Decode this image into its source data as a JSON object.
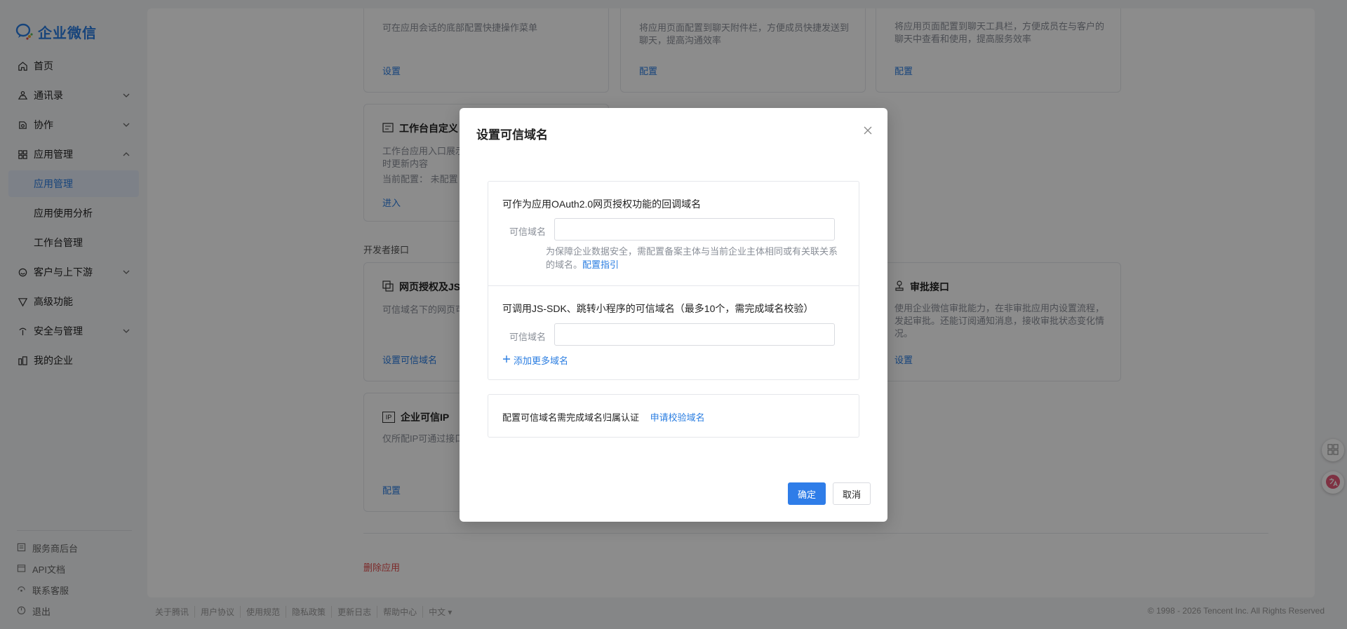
{
  "app": {
    "logo_text": "企业微信"
  },
  "sidebar": {
    "items": [
      {
        "label": "首页",
        "icon": "home-icon"
      },
      {
        "label": "通讯录",
        "icon": "contacts-icon",
        "expandable": true
      },
      {
        "label": "协作",
        "icon": "collab-icon",
        "expandable": true
      },
      {
        "label": "应用管理",
        "icon": "apps-icon",
        "expandable": true,
        "expanded": true
      },
      {
        "label": "应用管理",
        "sub": true,
        "active": true
      },
      {
        "label": "应用使用分析",
        "sub": true
      },
      {
        "label": "工作台管理",
        "sub": true
      },
      {
        "label": "客户与上下游",
        "icon": "customer-icon",
        "expandable": true
      },
      {
        "label": "高级功能",
        "icon": "advanced-icon"
      },
      {
        "label": "安全与管理",
        "icon": "security-icon",
        "expandable": true
      },
      {
        "label": "我的企业",
        "icon": "company-icon"
      }
    ],
    "footer": [
      {
        "label": "服务商后台",
        "icon": "vendor-icon"
      },
      {
        "label": "API文档",
        "icon": "api-doc-icon"
      },
      {
        "label": "联系客服",
        "icon": "support-icon"
      },
      {
        "label": "退出",
        "icon": "logout-icon"
      }
    ]
  },
  "main": {
    "cards_top": [
      {
        "desc": "可在应用会话的底部配置快捷操作菜单",
        "link": "设置"
      },
      {
        "desc": "将应用页面配置到聊天附件栏，方便成员快捷发送到聊天，提高沟通效率",
        "link": "配置"
      },
      {
        "desc": "将应用页面配置到聊天工具栏，方便成员在与客户的聊天中查看和使用，提高服务效率",
        "link": "配置"
      }
    ],
    "workbench_card": {
      "title": "工作台自定义",
      "desc": "工作台应用入口展示",
      "desc2": "时更新内容",
      "current_config": "当前配置：",
      "current_value": "未配置",
      "link": "进入"
    },
    "dev_section_label": "开发者接口",
    "oauth_card": {
      "title": "网页授权及JS",
      "desc": "可信域名下的网页可",
      "link": "设置可信域名"
    },
    "approval_card": {
      "title": "审批接口",
      "desc": "使用企业微信审批能力，在非审批应用内设置流程，发起审批。还能订阅通知消息，接收审批状态变化情况。",
      "link": "设置"
    },
    "ip_card": {
      "title": "企业可信IP",
      "icon_text": "IP",
      "desc": "仅所配IP可通过接口",
      "link": "配置"
    },
    "delete_label": "删除应用"
  },
  "footer": {
    "links": [
      "关于腾讯",
      "用户协议",
      "使用规范",
      "隐私政策",
      "更新日志",
      "帮助中心",
      "中文 ▾"
    ],
    "copyright": "© 1998 - 2026 Tencent Inc. All Rights Reserved"
  },
  "modal": {
    "title": "设置可信域名",
    "section1": {
      "heading": "可作为应用OAuth2.0网页授权功能的回调域名",
      "field_label": "可信域名",
      "value": "",
      "hint": "为保障企业数据安全，需配置备案主体与当前企业主体相同或有关联关系的域名。",
      "hint_link": "配置指引"
    },
    "section2": {
      "heading": "可调用JS-SDK、跳转小程序的可信域名（最多10个，需完成域名校验）",
      "field_label": "可信域名",
      "value": "",
      "add_label": "添加更多域名"
    },
    "verify": {
      "text": "配置可信域名需完成域名归属认证",
      "link": "申请校验域名"
    },
    "confirm_label": "确定",
    "cancel_label": "取消"
  },
  "colors": {
    "accent": "#2a7de1",
    "danger": "#e24b4b",
    "sidebar_active_bg": "#e3ebf7"
  }
}
